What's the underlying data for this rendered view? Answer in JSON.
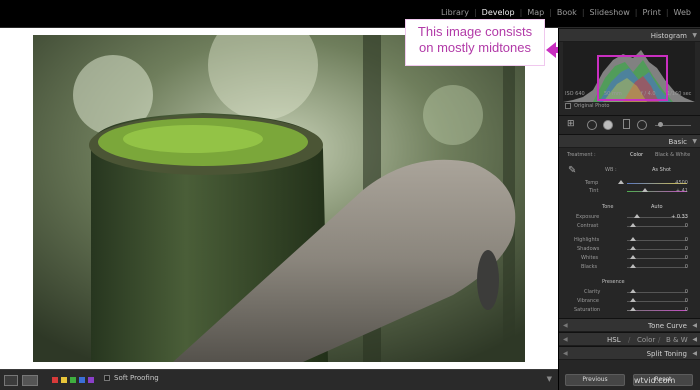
{
  "modules": [
    "Library",
    "Develop",
    "Map",
    "Book",
    "Slideshow",
    "Print",
    "Web"
  ],
  "active_module": "Develop",
  "callout": {
    "line1": "This image consists",
    "line2": "on mostly midtones"
  },
  "histogram": {
    "title": "Histogram",
    "iso": "ISO 640",
    "focal": "50 mm",
    "aperture": "f / 4.0",
    "shutter": "1/160 sec",
    "original_photo": "Original Photo"
  },
  "basic": {
    "title": "Basic",
    "treatment_label": "Treatment :",
    "color": "Color",
    "bw": "Black & White",
    "wb_label": "WB :",
    "wb_value": "As Shot",
    "temp_label": "Temp",
    "temp_value": "4500",
    "tint_label": "Tint",
    "tint_value": "+ 41",
    "tone_label": "Tone",
    "auto": "Auto",
    "exposure_label": "Exposure",
    "exposure_value": "+ 0.33",
    "contrast_label": "Contrast",
    "contrast_value": "0",
    "highlights_label": "Highlights",
    "highlights_value": "0",
    "shadows_label": "Shadows",
    "shadows_value": "0",
    "whites_label": "Whites",
    "whites_value": "0",
    "blacks_label": "Blacks",
    "blacks_value": "0",
    "presence_label": "Presence",
    "clarity_label": "Clarity",
    "clarity_value": "0",
    "vibrance_label": "Vibrance",
    "vibrance_value": "0",
    "saturation_label": "Saturation",
    "saturation_value": "0"
  },
  "panels": {
    "tone_curve": "Tone Curve",
    "hsl": "HSL",
    "hsl_color": "Color",
    "hsl_bw": "B & W",
    "split_toning": "Split Toning"
  },
  "buttons": {
    "previous": "Previous",
    "reset": "Reset"
  },
  "bottom": {
    "soft_proofing": "Soft Proofing"
  },
  "watermark": "wtvid.com",
  "colors": {
    "accent": "#c92fc0",
    "callout_text": "#b23aa8",
    "panel_bg": "#262626",
    "swatches": [
      "#d83a3a",
      "#e8c53a",
      "#3fae3f",
      "#3b6fd8",
      "#8a3fc8"
    ]
  }
}
